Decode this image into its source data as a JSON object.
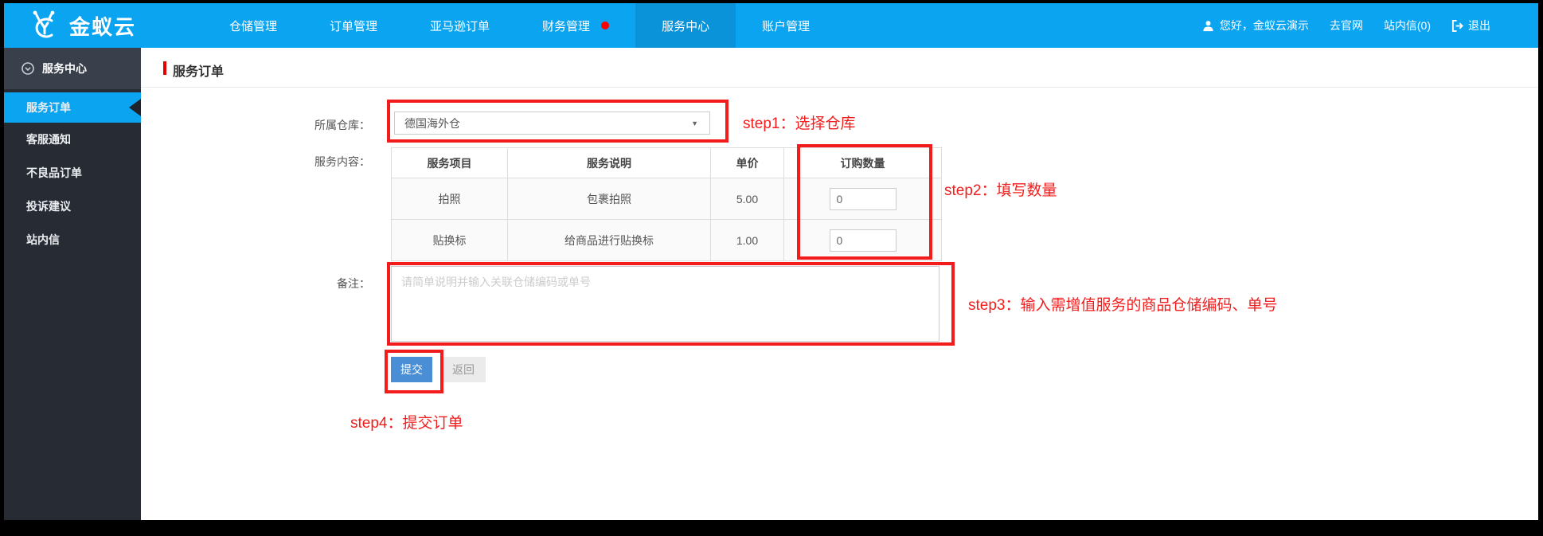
{
  "topbar": {
    "logo_text": "金蚁云",
    "nav": [
      {
        "label": "仓储管理"
      },
      {
        "label": "订单管理"
      },
      {
        "label": "亚马逊订单"
      },
      {
        "label": "财务管理"
      },
      {
        "label": "服务中心"
      },
      {
        "label": "账户管理"
      }
    ],
    "user_greeting": "您好，金蚁云演示",
    "links": [
      "去官网",
      "站内信(0)",
      "退出"
    ]
  },
  "sidebar": {
    "header": "服务中心",
    "items": [
      {
        "label": "服务订单"
      },
      {
        "label": "客服通知"
      },
      {
        "label": "不良品订单"
      },
      {
        "label": "投诉建议"
      },
      {
        "label": "站内信"
      }
    ]
  },
  "main": {
    "page_title": "服务订单",
    "form": {
      "warehouse_label": "所属仓库：",
      "warehouse_value": "德国海外仓",
      "service_label": "服务内容：",
      "table": {
        "headers": [
          "服务项目",
          "服务说明",
          "单价",
          "订购数量"
        ],
        "rows": [
          {
            "item": "拍照",
            "desc": "包裹拍照",
            "price": "5.00",
            "qty": "0"
          },
          {
            "item": "贴换标",
            "desc": "给商品进行贴换标",
            "price": "1.00",
            "qty": "0"
          }
        ]
      },
      "remark_label": "备注：",
      "remark_placeholder": "请简单说明并输入关联仓储编码或单号",
      "submit_label": "提交",
      "back_label": "返回"
    },
    "annotations": [
      "step1：选择仓库",
      "step2：填写数量",
      "step3：输入需增值服务的商品仓储编码、单号",
      "step4：提交订单"
    ]
  },
  "colors": {
    "accent": "#0ba4f1",
    "accent-dark": "#0b93da",
    "sidebar-bg": "#262b34",
    "sidebar-header-bg": "#3a404b",
    "annotation": "#f31c1c",
    "submit-blue": "#4a8fd6",
    "notification-red": "#ff0000"
  }
}
